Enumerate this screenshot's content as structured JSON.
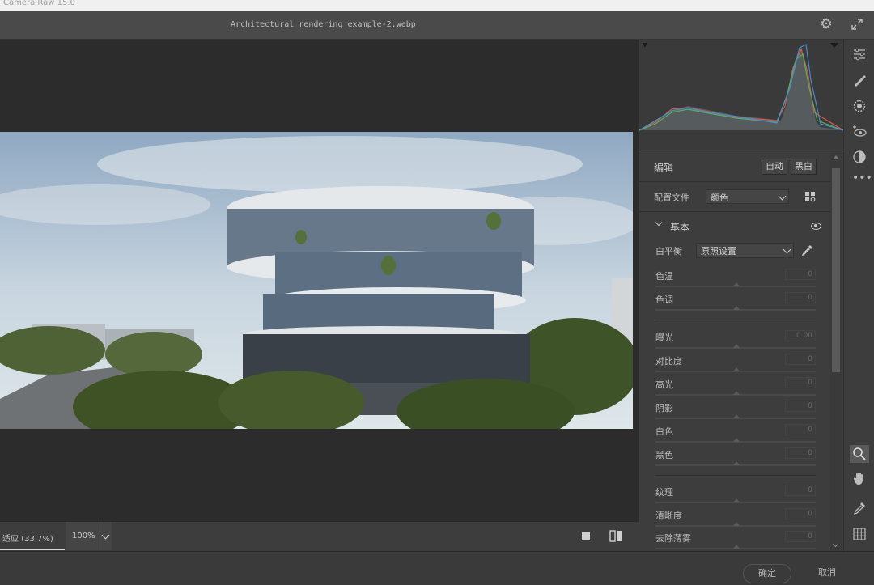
{
  "window": {
    "title": "Camera Raw 15.0"
  },
  "file": {
    "name": "Architectural rendering example-2.webp"
  },
  "header_icons": {
    "settings": "gear-icon",
    "fullscreen": "expand-icon"
  },
  "view_bar": {
    "fit_label": "适应 (33.7%)",
    "zoom_value": "100%"
  },
  "footer": {
    "ok_label": "确定",
    "cancel_label": "取消"
  },
  "edit": {
    "title": "编辑",
    "auto_label": "自动",
    "bw_label": "黑白",
    "profile_label": "配置文件",
    "profile_value": "颜色",
    "basic_title": "基本",
    "wb_label": "白平衡",
    "wb_value": "原照设置",
    "sliders": [
      {
        "label": "色温",
        "value": "0"
      },
      {
        "label": "色调",
        "value": "0"
      },
      {
        "label": "曝光",
        "value": "0.00"
      },
      {
        "label": "对比度",
        "value": "0"
      },
      {
        "label": "高光",
        "value": "0"
      },
      {
        "label": "阴影",
        "value": "0"
      },
      {
        "label": "白色",
        "value": "0"
      },
      {
        "label": "黑色",
        "value": "0"
      },
      {
        "label": "纹理",
        "value": "0"
      },
      {
        "label": "清晰度",
        "value": "0"
      },
      {
        "label": "去除薄雾",
        "value": "0"
      }
    ]
  },
  "colors": {
    "panel": "#3d3d3d",
    "canvas": "#2c2c2c",
    "accent": "#d8d8d8"
  }
}
